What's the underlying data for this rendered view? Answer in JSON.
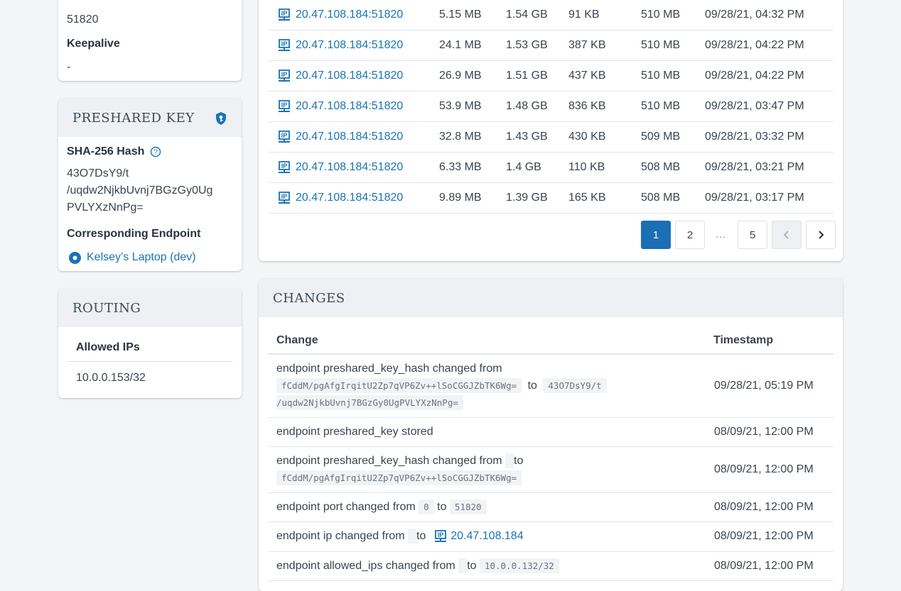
{
  "keepalive_card": {
    "port_value": "51820",
    "keepalive_label": "Keepalive",
    "keepalive_value": "-"
  },
  "psk_card": {
    "title": "PRESHARED KEY",
    "hash_label": "SHA-256 Hash",
    "hash_lines": [
      "43O7DsY9/t",
      "/uqdw2NjkbUvnj7BGzGy0Ug",
      "PVLYXzNnPg="
    ],
    "endpoint_label": "Corresponding Endpoint",
    "endpoint_name": "Kelsey’s Laptop (dev)"
  },
  "routing_card": {
    "title": "ROUTING",
    "allowed_label": "Allowed IPs",
    "allowed_value": "10.0.0.153/32"
  },
  "transfers": {
    "rows": [
      {
        "endpoint": "20.47.108.184:51820",
        "a": "5.15 MB",
        "b": "1.54 GB",
        "c": "91 KB",
        "d": "510 MB",
        "time": "09/28/21, 04:32 PM"
      },
      {
        "endpoint": "20.47.108.184:51820",
        "a": "24.1 MB",
        "b": "1.53 GB",
        "c": "387 KB",
        "d": "510 MB",
        "time": "09/28/21, 04:22 PM"
      },
      {
        "endpoint": "20.47.108.184:51820",
        "a": "26.9 MB",
        "b": "1.51 GB",
        "c": "437 KB",
        "d": "510 MB",
        "time": "09/28/21, 04:22 PM"
      },
      {
        "endpoint": "20.47.108.184:51820",
        "a": "53.9 MB",
        "b": "1.48 GB",
        "c": "836 KB",
        "d": "510 MB",
        "time": "09/28/21, 03:47 PM"
      },
      {
        "endpoint": "20.47.108.184:51820",
        "a": "32.8 MB",
        "b": "1.43 GB",
        "c": "430 KB",
        "d": "509 MB",
        "time": "09/28/21, 03:32 PM"
      },
      {
        "endpoint": "20.47.108.184:51820",
        "a": "6.33 MB",
        "b": "1.4 GB",
        "c": "110 KB",
        "d": "508 MB",
        "time": "09/28/21, 03:21 PM"
      },
      {
        "endpoint": "20.47.108.184:51820",
        "a": "9.89 MB",
        "b": "1.39 GB",
        "c": "165 KB",
        "d": "508 MB",
        "time": "09/28/21, 03:17 PM"
      }
    ],
    "pager": {
      "p1": "1",
      "p2": "2",
      "ellipsis": "…",
      "p5": "5",
      "prev": "‹",
      "next": "›"
    }
  },
  "changes": {
    "title": "CHANGES",
    "col_change": "Change",
    "col_timestamp": "Timestamp",
    "rows": [
      {
        "text": "endpoint preshared_key_hash changed from",
        "from": "fCddM/pgAfgIrqitU2Zp7qVP6Zv++lSoCGGJZbTK6Wg=",
        "to_word": "to",
        "to_line1": "43O7DsY9/t",
        "to_line2": "/uqdw2NjkbUvnj7BGzGy0UgPVLYXzNnPg=",
        "time": "09/28/21, 05:19 PM"
      },
      {
        "text": "endpoint preshared_key stored",
        "time": "08/09/21, 12:00 PM"
      },
      {
        "text": "endpoint preshared_key_hash changed from",
        "to_word": "to",
        "to_value": "fCddM/pgAfgIrqitU2Zp7qVP6Zv++lSoCGGJZbTK6Wg=",
        "time": "08/09/21, 12:00 PM"
      },
      {
        "text": "endpoint port changed from",
        "from": "0",
        "to_word": "to",
        "to_value": "51820",
        "time": "08/09/21, 12:00 PM"
      },
      {
        "text": "endpoint ip changed from",
        "to_word": "to",
        "to_value": "20.47.108.184",
        "time": "08/09/21, 12:00 PM"
      },
      {
        "text": "endpoint allowed_ips changed from",
        "to_word": "to",
        "to_value": "10.0.0.132/32",
        "time": "08/09/21, 12:00 PM"
      }
    ]
  },
  "colors": {
    "link": "#1a73b8",
    "header_bg": "#eef0f3",
    "active_page": "#1a6fb5"
  }
}
